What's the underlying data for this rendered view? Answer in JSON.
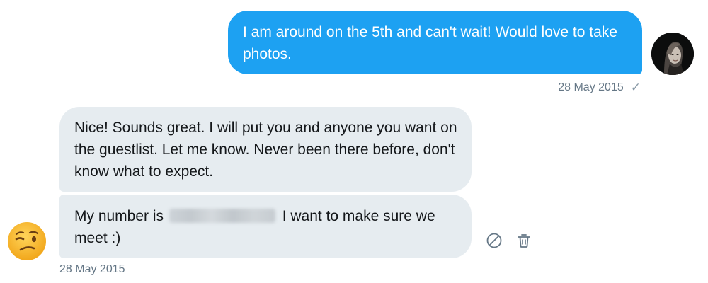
{
  "sent_message": {
    "text": "I am around on the 5th and can't wait!  Would love to take photos.",
    "timestamp": "28 May 2015",
    "status_icon": "check-icon",
    "status_glyph": "✓"
  },
  "received_messages": [
    {
      "text": "Nice! Sounds great. I will put you and anyone you want on the guestlist. Let me know. Never been there before, don't know what to expect."
    },
    {
      "text_before": "My number is",
      "text_after": "I want to make sure we meet :)"
    }
  ],
  "received_timestamp": "28 May 2015",
  "sender_avatar_icon": "winking-face-emoji",
  "message_actions": [
    "report-icon",
    "delete-icon"
  ],
  "colors": {
    "sent_bubble": "#1da1f2",
    "received_bubble": "#e6ecf0",
    "timestamp_text": "#657786"
  }
}
